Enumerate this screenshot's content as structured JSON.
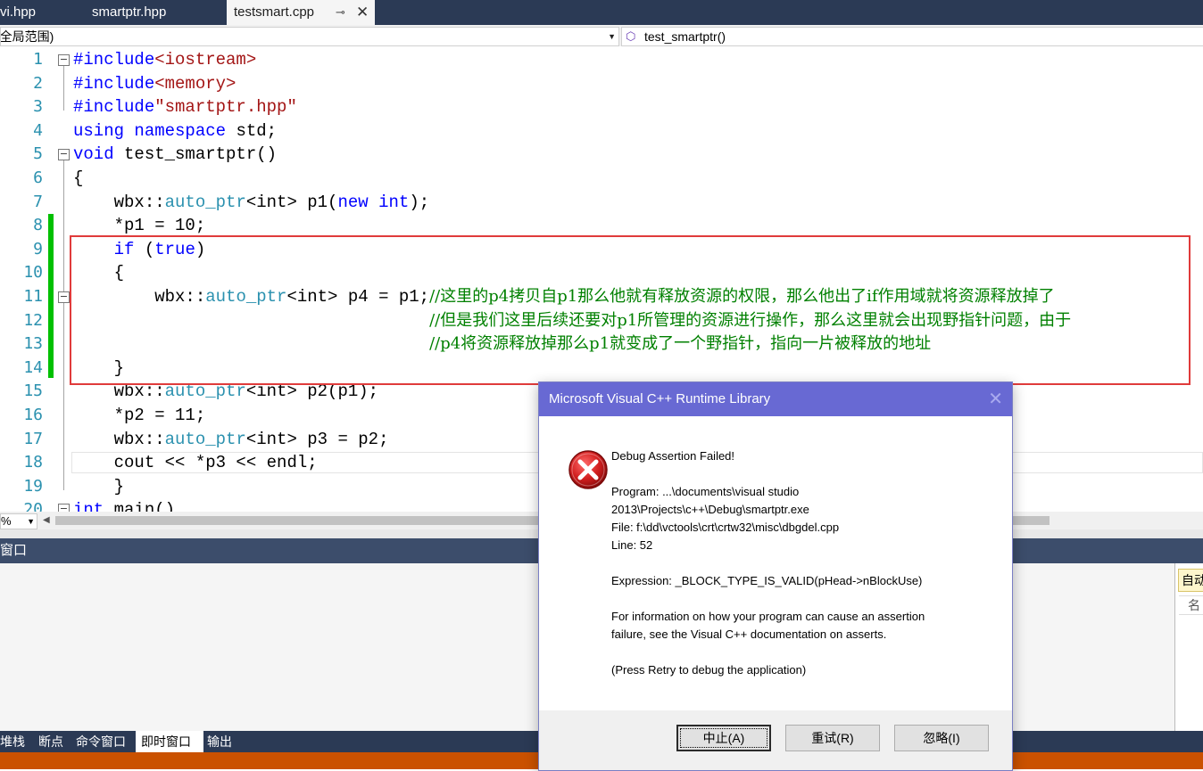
{
  "tabs": [
    {
      "label": "vi.hpp"
    },
    {
      "label": "smartptr.hpp"
    },
    {
      "label": "testsmart.cpp",
      "pin_icon": "pin-icon",
      "close_icon": "close-icon"
    }
  ],
  "navbar": {
    "scope_combo": "(全局范围)",
    "member_combo": "test_smartptr()",
    "member_icon": "method-cube-icon"
  },
  "editor": {
    "line_numbers": [
      "1",
      "2",
      "3",
      "4",
      "5",
      "6",
      "7",
      "8",
      "9",
      "10",
      "11",
      "12",
      "13",
      "14",
      "15",
      "16",
      "17",
      "18",
      "19",
      "20"
    ],
    "lines": [
      "#include<iostream>",
      "#include<memory>",
      "#include\"smartptr.hpp\"",
      "using namespace std;",
      "void test_smartptr()",
      "{",
      "    wbx::auto_ptr<int> p1(new int);",
      "    *p1 = 10;",
      "    if (true)",
      "    {",
      "        wbx::auto_ptr<int> p4 = p1;//这里的p4拷贝自p1那么他就有释放资源的权限，那么他出了if作用域就将资源释放掉了",
      "                                   //但是我们这里后续还要对p1所管理的资源进行操作，那么这里就会出现野指针问题，由于",
      "                                   //p4将资源释放掉那么p1就变成了一个野指针，指向一片被释放的地址",
      "    }",
      "    wbx::auto_ptr<int> p2(p1);",
      "    *p2 = 11;",
      "    wbx::auto_ptr<int> p3 = p2;",
      "    cout << *p3 << endl;",
      "    }",
      "int main()"
    ],
    "zoom": "%"
  },
  "panel": {
    "title": "窗口",
    "right_tab": "自动",
    "right_column": "名",
    "bottom_tabs": [
      "堆栈",
      "断点",
      "命令窗口",
      "即时窗口",
      "输出"
    ]
  },
  "dialog": {
    "title": "Microsoft Visual C++ Runtime Library",
    "icon": "error-icon",
    "heading": "Debug Assertion Failed!",
    "program_line1": "Program: ...\\documents\\visual studio",
    "program_line2": "2013\\Projects\\c++\\Debug\\smartptr.exe",
    "file": "File: f:\\dd\\vctools\\crt\\crtw32\\misc\\dbgdel.cpp",
    "line": "Line: 52",
    "expression": "Expression: _BLOCK_TYPE_IS_VALID(pHead->nBlockUse)",
    "info1": "For information on how your program can cause an assertion",
    "info2": "failure, see the Visual C++ documentation on asserts.",
    "press": "(Press Retry to debug the application)",
    "buttons": {
      "abort": "中止(A)",
      "retry": "重试(R)",
      "ignore": "忽略(I)"
    }
  },
  "colors": {
    "keyword": "#0000ff",
    "type": "#2b91af",
    "string": "#a31515",
    "comment": "#008000",
    "annotation_box": "#e03b3b",
    "dialog_titlebar": "#6869d3",
    "statusbar": "#ca5100"
  }
}
